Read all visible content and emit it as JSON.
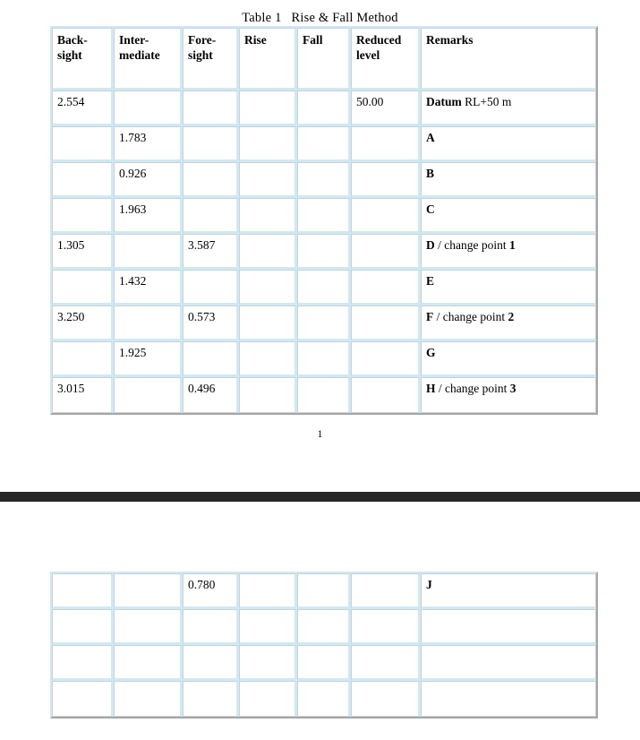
{
  "document": {
    "title_prefix": "Table 1",
    "title_main": "Rise & Fall Method",
    "page_number": "1"
  },
  "table": {
    "headers": {
      "backsight": "Back-\nsight",
      "backsight_line1": "Back-",
      "backsight_line2": "sight",
      "intermediate_line1": "Inter-",
      "intermediate_line2": "mediate",
      "foresight_line1": "Fore-",
      "foresight_line2": "sight",
      "rise": "Rise",
      "fall": "Fall",
      "reduced_level_line1": "Reduced",
      "reduced_level_line2": "level",
      "remarks": "Remarks"
    },
    "rows": [
      {
        "backsight": "2.554",
        "intermediate": "",
        "foresight": "",
        "rise": "",
        "fall": "",
        "reduced_level": "50.00",
        "remarks_bold": "Datum",
        "remarks_rest": " RL+50 m",
        "remarks_tail_bold": ""
      },
      {
        "backsight": "",
        "intermediate": "1.783",
        "foresight": "",
        "rise": "",
        "fall": "",
        "reduced_level": "",
        "remarks_bold": "A",
        "remarks_rest": "",
        "remarks_tail_bold": ""
      },
      {
        "backsight": "",
        "intermediate": "0.926",
        "foresight": "",
        "rise": "",
        "fall": "",
        "reduced_level": "",
        "remarks_bold": "B",
        "remarks_rest": "",
        "remarks_tail_bold": ""
      },
      {
        "backsight": "",
        "intermediate": "1.963",
        "foresight": "",
        "rise": "",
        "fall": "",
        "reduced_level": "",
        "remarks_bold": "C",
        "remarks_rest": "",
        "remarks_tail_bold": ""
      },
      {
        "backsight": "1.305",
        "intermediate": "",
        "foresight": "3.587",
        "rise": "",
        "fall": "",
        "reduced_level": "",
        "remarks_bold": "D",
        "remarks_rest": " / change point ",
        "remarks_tail_bold": "1"
      },
      {
        "backsight": "",
        "intermediate": "1.432",
        "foresight": "",
        "rise": "",
        "fall": "",
        "reduced_level": "",
        "remarks_bold": "E",
        "remarks_rest": "",
        "remarks_tail_bold": ""
      },
      {
        "backsight": "3.250",
        "intermediate": "",
        "foresight": "0.573",
        "rise": "",
        "fall": "",
        "reduced_level": "",
        "remarks_bold": "F",
        "remarks_rest": " / change point ",
        "remarks_tail_bold": "2"
      },
      {
        "backsight": "",
        "intermediate": "1.925",
        "foresight": "",
        "rise": "",
        "fall": "",
        "reduced_level": "",
        "remarks_bold": "G",
        "remarks_rest": "",
        "remarks_tail_bold": ""
      },
      {
        "backsight": "3.015",
        "intermediate": "",
        "foresight": "0.496",
        "rise": "",
        "fall": "",
        "reduced_level": "",
        "remarks_bold": "H",
        "remarks_rest": " / change point ",
        "remarks_tail_bold": "3"
      }
    ]
  },
  "table_continued": {
    "rows": [
      {
        "backsight": "",
        "intermediate": "",
        "foresight": "0.780",
        "rise": "",
        "fall": "",
        "reduced_level": "",
        "remarks_bold": "J",
        "remarks_rest": "",
        "remarks_tail_bold": ""
      },
      {
        "backsight": "",
        "intermediate": "",
        "foresight": "",
        "rise": "",
        "fall": "",
        "reduced_level": "",
        "remarks_bold": "",
        "remarks_rest": "",
        "remarks_tail_bold": ""
      },
      {
        "backsight": "",
        "intermediate": "",
        "foresight": "",
        "rise": "",
        "fall": "",
        "reduced_level": "",
        "remarks_bold": "",
        "remarks_rest": "",
        "remarks_tail_bold": ""
      },
      {
        "backsight": "",
        "intermediate": "",
        "foresight": "",
        "rise": "",
        "fall": "",
        "reduced_level": "",
        "remarks_bold": "",
        "remarks_rest": "",
        "remarks_tail_bold": ""
      }
    ]
  },
  "colors": {
    "cell_border": "#cdeaf5",
    "table_shadow": "#a6a6a6",
    "page_break_bar": "#262626",
    "text": "#000000"
  }
}
